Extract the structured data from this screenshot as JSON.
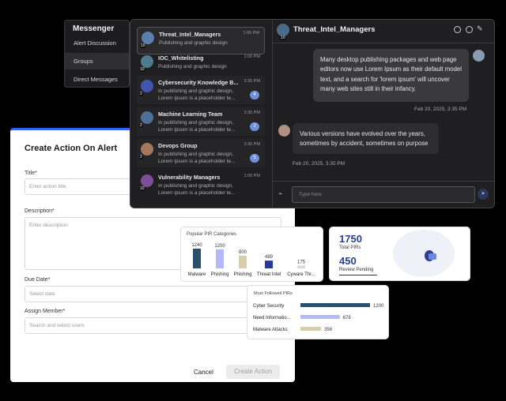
{
  "messenger_menu": {
    "title": "Messenger",
    "items": [
      "Alert Discussion",
      "Groups",
      "Direct Messages"
    ],
    "selected": "Groups"
  },
  "conversations": [
    {
      "name": "Threat_Intel_Managers",
      "preview": "Publishing and graphic design",
      "time": "1:00 PM",
      "members": "10",
      "badge": ""
    },
    {
      "name": "IOC_Whitelisting",
      "preview": "Publishing and graphic design",
      "time": "1:00 PM",
      "members": "10",
      "badge": ""
    },
    {
      "name": "Cybersecurity Knowledge B...",
      "preview": "In publishing and graphic design, Lorem ipsum is a placeholder te...",
      "time": "3:35 PM",
      "members": "2",
      "badge": "4"
    },
    {
      "name": "Machine Learning Team",
      "preview": "In publishing and graphic design, Lorem ipsum is a placeholder te...",
      "time": "3:35 PM",
      "members": "2",
      "badge": "2"
    },
    {
      "name": "Devops Group",
      "preview": "In publishing and graphic design, Lorem ipsum is a placeholder te...",
      "time": "3:35 PM",
      "members": "2",
      "badge": "5"
    },
    {
      "name": "Vulnerability Managers",
      "preview": "In publishing and graphic design, Lorem ipsum is a placeholder te...",
      "time": "1:00 PM",
      "members": "10",
      "badge": ""
    }
  ],
  "thread": {
    "title": "Threat_Intel_Managers",
    "avatar_count": "10",
    "messages": [
      {
        "text": "Many desktop publishing packages and web page editors now use Lorem Ipsum as their default model text, and a search for 'lorem ipsum' will uncover many web sites still in their infancy.",
        "time": "Feb 20, 2025, 3:35 PM",
        "side": "right"
      },
      {
        "text": "Various versions have evolved over the years, sometimes by accident, sometimes on purpose",
        "time": "Feb 20, 2025, 3:35 PM",
        "side": "left"
      }
    ],
    "input_placeholder": "Type here"
  },
  "form": {
    "title": "Create Action On Alert",
    "title_label": "Title*",
    "title_placeholder": "Enter action title",
    "description_label": "Description*",
    "description_placeholder": "Enter description",
    "due_label": "Due Date*",
    "due_placeholder": "Select date",
    "assign_label": "Assign Member*",
    "assign_placeholder": "Search and select users",
    "cancel": "Cancel",
    "create": "Create Action"
  },
  "popular": {
    "title": "Popular PIR Categories",
    "bars": [
      {
        "label": "Malware",
        "value": "1240",
        "color": "#2d4f6e"
      },
      {
        "label": "Phishing",
        "value": "1200",
        "color": "#b3baf7"
      },
      {
        "label": "Phishing",
        "value": "800",
        "color": "#d9ceac"
      },
      {
        "label": "Threat Intel",
        "value": "489",
        "color": "#27379a"
      },
      {
        "label": "Cyware Thr...",
        "value": "175",
        "color": "#d9d9dd"
      }
    ]
  },
  "stats": {
    "total_value": "1750",
    "total_label": "Total PIRs",
    "pending_value": "450",
    "pending_label": "Review Pending"
  },
  "followed": {
    "title": "Most Followed PIRs",
    "rows": [
      {
        "label": "Cyber Security",
        "value": "1200",
        "color": "#2d4f6e"
      },
      {
        "label": "Need Informatio...",
        "value": "678",
        "color": "#b3baf7"
      },
      {
        "label": "Malware Attacks",
        "value": "356",
        "color": "#d9ceac"
      }
    ]
  }
}
